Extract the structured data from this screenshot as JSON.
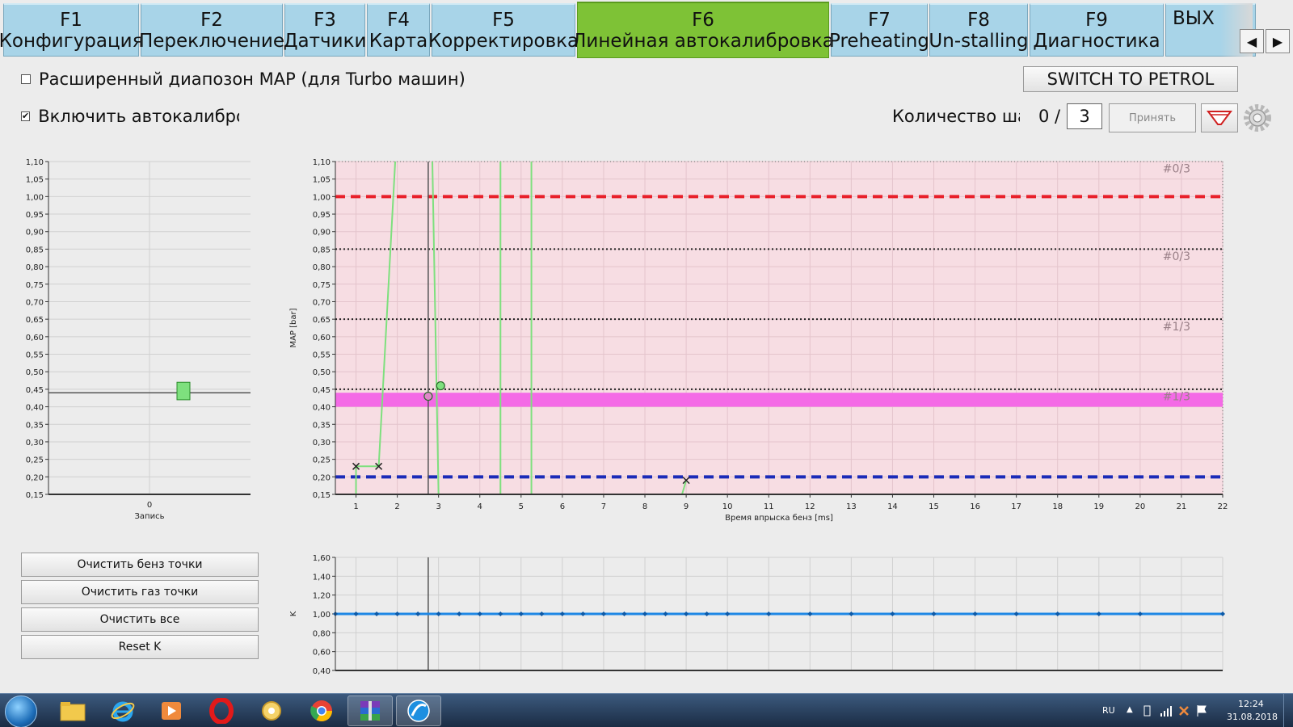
{
  "tabs": [
    {
      "key": "F1",
      "label": "Конфигурация"
    },
    {
      "key": "F2",
      "label": "Переключение"
    },
    {
      "key": "F3",
      "label": "Датчики"
    },
    {
      "key": "F4",
      "label": "Карта"
    },
    {
      "key": "F5",
      "label": "Корректировка"
    },
    {
      "key": "F6",
      "label": "Линейная автокалибровка"
    },
    {
      "key": "F7",
      "label": "Preheating"
    },
    {
      "key": "F8",
      "label": "Un-stalling"
    },
    {
      "key": "F9",
      "label": "Диагностика"
    }
  ],
  "active_tab": "F6",
  "exit_tab": "ВЫХ",
  "options": {
    "extended_map_label": "Расширенный диапозон MAP (для Turbo машин)",
    "extended_map_checked": false,
    "autocal_label": "Включить автокалибровк",
    "autocal_checked": true
  },
  "switch_button": "SWITCH TO PETROL",
  "steps": {
    "label": "Количество шаг",
    "current": "0 /",
    "value": "3",
    "accept": "Принять"
  },
  "left_buttons": [
    "Очистить бенз точки",
    "Очистить газ точки",
    "Очистить все",
    "Reset K"
  ],
  "taskbar": {
    "lang": "RU",
    "time": "12:24",
    "date": "31.08.2018"
  },
  "colors": {
    "active_tab": "#7ec236",
    "tab": "#a8d4e8",
    "red_limit": "#e8202a",
    "blue_limit": "#1a2bb8",
    "band": "#f46ae6",
    "k_line": "#1e88e5",
    "trace": "#7ee07e"
  },
  "chart_data": [
    {
      "type": "scatter",
      "title": "",
      "xlabel": "Запись",
      "ylabel": "",
      "x_ticks": [
        "0"
      ],
      "yticks": [
        "1,10",
        "1,05",
        "1,00",
        "0,95",
        "0,90",
        "0,85",
        "0,80",
        "0,75",
        "0,70",
        "0,65",
        "0,60",
        "0,55",
        "0,50",
        "0,45",
        "0,40",
        "0,35",
        "0,30",
        "0,25",
        "0,20",
        "0,15"
      ],
      "ylim": [
        0.15,
        1.1
      ],
      "reference_line": 0.44,
      "marker": {
        "x": 0.4,
        "y_low": 0.42,
        "y_high": 0.47,
        "color": "#7ee07e"
      }
    },
    {
      "type": "line",
      "title": "",
      "xlabel": "Время впрыска бенз [ms]",
      "ylabel": "MAP [bar]",
      "xlim": [
        0.5,
        22
      ],
      "ylim": [
        0.15,
        1.1
      ],
      "x_ticks": [
        "1",
        "2",
        "3",
        "4",
        "5",
        "6",
        "7",
        "8",
        "9",
        "10",
        "11",
        "12",
        "13",
        "14",
        "15",
        "16",
        "17",
        "18",
        "19",
        "20",
        "21",
        "22"
      ],
      "yticks": [
        "1,10",
        "1,05",
        "1,00",
        "0,95",
        "0,90",
        "0,85",
        "0,80",
        "0,75",
        "0,70",
        "0,65",
        "0,60",
        "0,55",
        "0,50",
        "0,45",
        "0,40",
        "0,35",
        "0,30",
        "0,25",
        "0,20",
        "0,15"
      ],
      "limits": [
        {
          "name": "upper",
          "y": 1.0,
          "color": "#e8202a",
          "style": "dashed"
        },
        {
          "name": "lower",
          "y": 0.2,
          "color": "#1a2bb8",
          "style": "dashed"
        }
      ],
      "dotted_levels": [
        0.85,
        0.65,
        0.45
      ],
      "band": {
        "y_low": 0.4,
        "y_high": 0.44
      },
      "zone_labels": [
        {
          "text": "#0/3",
          "y": 1.08
        },
        {
          "text": "#0/3",
          "y": 0.83
        },
        {
          "text": "#1/3",
          "y": 0.63
        },
        {
          "text": "#1/3",
          "y": 0.43
        }
      ],
      "cursor_x": 2.75,
      "series": [
        {
          "values": [
            [
              1.0,
              0.15
            ],
            [
              1.0,
              0.23
            ],
            [
              1.55,
              0.23
            ],
            [
              1.95,
              1.1
            ]
          ]
        },
        {
          "values": [
            [
              2.85,
              1.1
            ],
            [
              3.0,
              0.15
            ]
          ]
        },
        {
          "values": [
            [
              4.5,
              0.15
            ],
            [
              4.5,
              1.1
            ]
          ]
        },
        {
          "values": [
            [
              5.25,
              0.15
            ],
            [
              5.25,
              1.1
            ]
          ]
        },
        {
          "values": [
            [
              8.9,
              0.15
            ],
            [
              9.0,
              0.19
            ]
          ]
        }
      ],
      "points": [
        {
          "x": 1.0,
          "y": 0.23,
          "marker": "x"
        },
        {
          "x": 1.55,
          "y": 0.23,
          "marker": "x"
        },
        {
          "x": 2.75,
          "y": 0.43,
          "marker": "circle"
        },
        {
          "x": 3.05,
          "y": 0.46,
          "marker": "circle"
        },
        {
          "x": 9.0,
          "y": 0.19,
          "marker": "x"
        }
      ]
    },
    {
      "type": "line",
      "title": "",
      "xlabel": "",
      "ylabel": "K",
      "xlim": [
        0.5,
        22
      ],
      "ylim": [
        0.4,
        1.6
      ],
      "yticks": [
        "1,60",
        "1,40",
        "1,20",
        "1,00",
        "0,80",
        "0,60",
        "0,40"
      ],
      "cursor_x": 2.75,
      "x": [
        0.5,
        1,
        1.5,
        2,
        2.5,
        3,
        3.5,
        4,
        4.5,
        5,
        5.5,
        6,
        6.5,
        7,
        7.5,
        8,
        8.5,
        9,
        9.5,
        10,
        11,
        12,
        13,
        14,
        15,
        16,
        17,
        18,
        19,
        20,
        22
      ],
      "series": [
        {
          "values": [
            1.0,
            1.0,
            1.0,
            1.0,
            1.0,
            1.0,
            1.0,
            1.0,
            1.0,
            1.0,
            1.0,
            1.0,
            1.0,
            1.0,
            1.0,
            1.0,
            1.0,
            1.0,
            1.0,
            1.0,
            1.0,
            1.0,
            1.0,
            1.0,
            1.0,
            1.0,
            1.0,
            1.0,
            1.0,
            1.0,
            1.0
          ]
        }
      ]
    }
  ]
}
